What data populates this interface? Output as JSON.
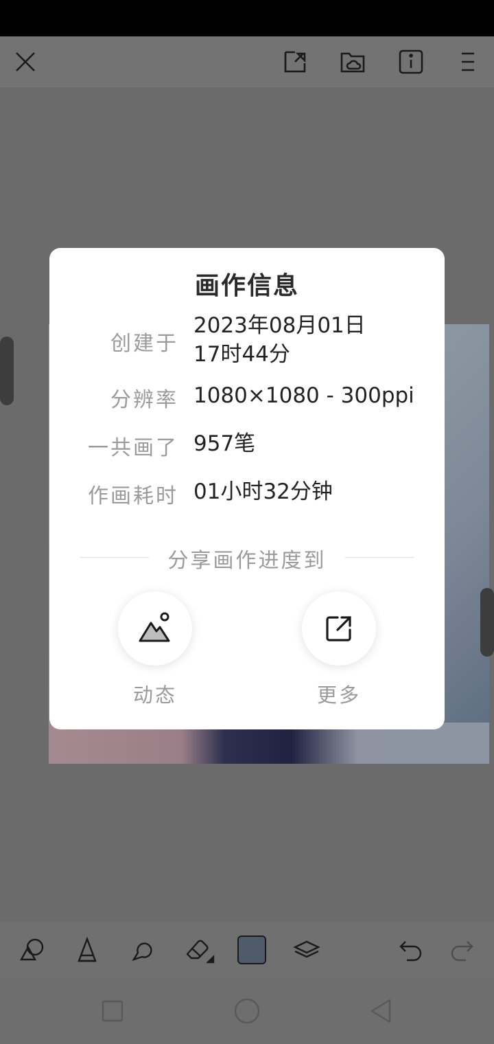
{
  "dialog": {
    "title": "画作信息",
    "rows": [
      {
        "label": "创建于",
        "value": "2023年08月01日 17时44分"
      },
      {
        "label": "分辨率",
        "value": "1080×1080 - 300ppi"
      },
      {
        "label": "一共画了",
        "value": "957笔"
      },
      {
        "label": "作画耗时",
        "value": "01小时32分钟"
      }
    ],
    "share_heading": "分享画作进度到",
    "share_buttons": [
      {
        "label": "动态",
        "icon": "mountain-image-icon"
      },
      {
        "label": "更多",
        "icon": "external-share-icon"
      }
    ]
  },
  "topbar": {
    "icons": [
      "close-icon",
      "import-icon",
      "cloud-folder-icon",
      "info-icon",
      "menu-icon"
    ]
  },
  "toolbar": {
    "icons": [
      "shapes-icon",
      "pencil-icon",
      "smudge-icon",
      "eraser-icon",
      "color-swatch",
      "layers-icon",
      "undo-icon",
      "redo-icon"
    ],
    "current_color": "#4f5a6a"
  },
  "navbar": {
    "icons": [
      "recent-apps-icon",
      "home-icon",
      "back-icon"
    ]
  }
}
